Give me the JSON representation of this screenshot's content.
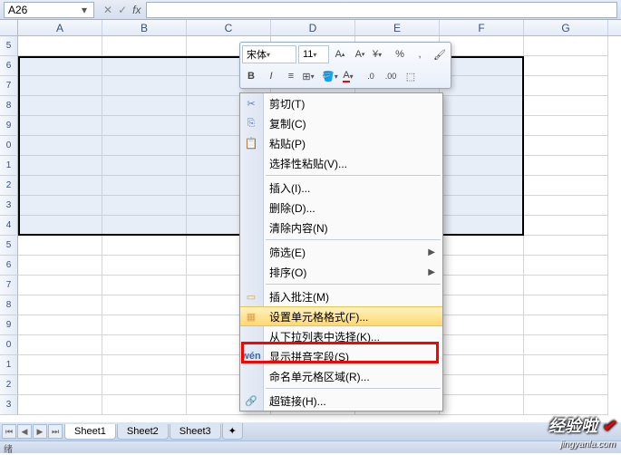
{
  "formula_bar": {
    "name_box_value": "A26",
    "fx_label": "fx"
  },
  "columns": [
    "A",
    "B",
    "C",
    "D",
    "E",
    "F",
    "G"
  ],
  "visible_rows": [
    "5",
    "6",
    "7",
    "8",
    "9",
    "0",
    "1",
    "2",
    "3",
    "4",
    "5",
    "6",
    "7",
    "8",
    "9",
    "0",
    "1",
    "2",
    "3"
  ],
  "mini_toolbar": {
    "font_name": "宋体",
    "font_size": "11",
    "buttons": {
      "grow": "A",
      "shrink": "A",
      "currency": "¥",
      "percent": "%",
      "comma": ",",
      "bold": "B",
      "italic": "I",
      "font_color": "A",
      "decrease_dec": ".0",
      "increase_dec": ".00"
    }
  },
  "context_menu": {
    "cut": "剪切(T)",
    "copy": "复制(C)",
    "paste": "粘贴(P)",
    "paste_special": "选择性粘贴(V)...",
    "insert": "插入(I)...",
    "delete": "删除(D)...",
    "clear": "清除内容(N)",
    "filter": "筛选(E)",
    "sort": "排序(O)",
    "insert_comment": "插入批注(M)",
    "format_cells": "设置单元格格式(F)...",
    "pick_list": "从下拉列表中选择(K)...",
    "phonetic": "显示拼音字段(S)",
    "name_range": "命名单元格区域(R)...",
    "hyperlink": "超链接(H)...",
    "pinyin_icon": "wén"
  },
  "sheet_tabs": {
    "sheets": [
      "Sheet1",
      "Sheet2",
      "Sheet3"
    ]
  },
  "status_bar": {
    "text": "绪"
  },
  "watermark": {
    "text": "经验啦",
    "url": "jingyanla.com"
  }
}
